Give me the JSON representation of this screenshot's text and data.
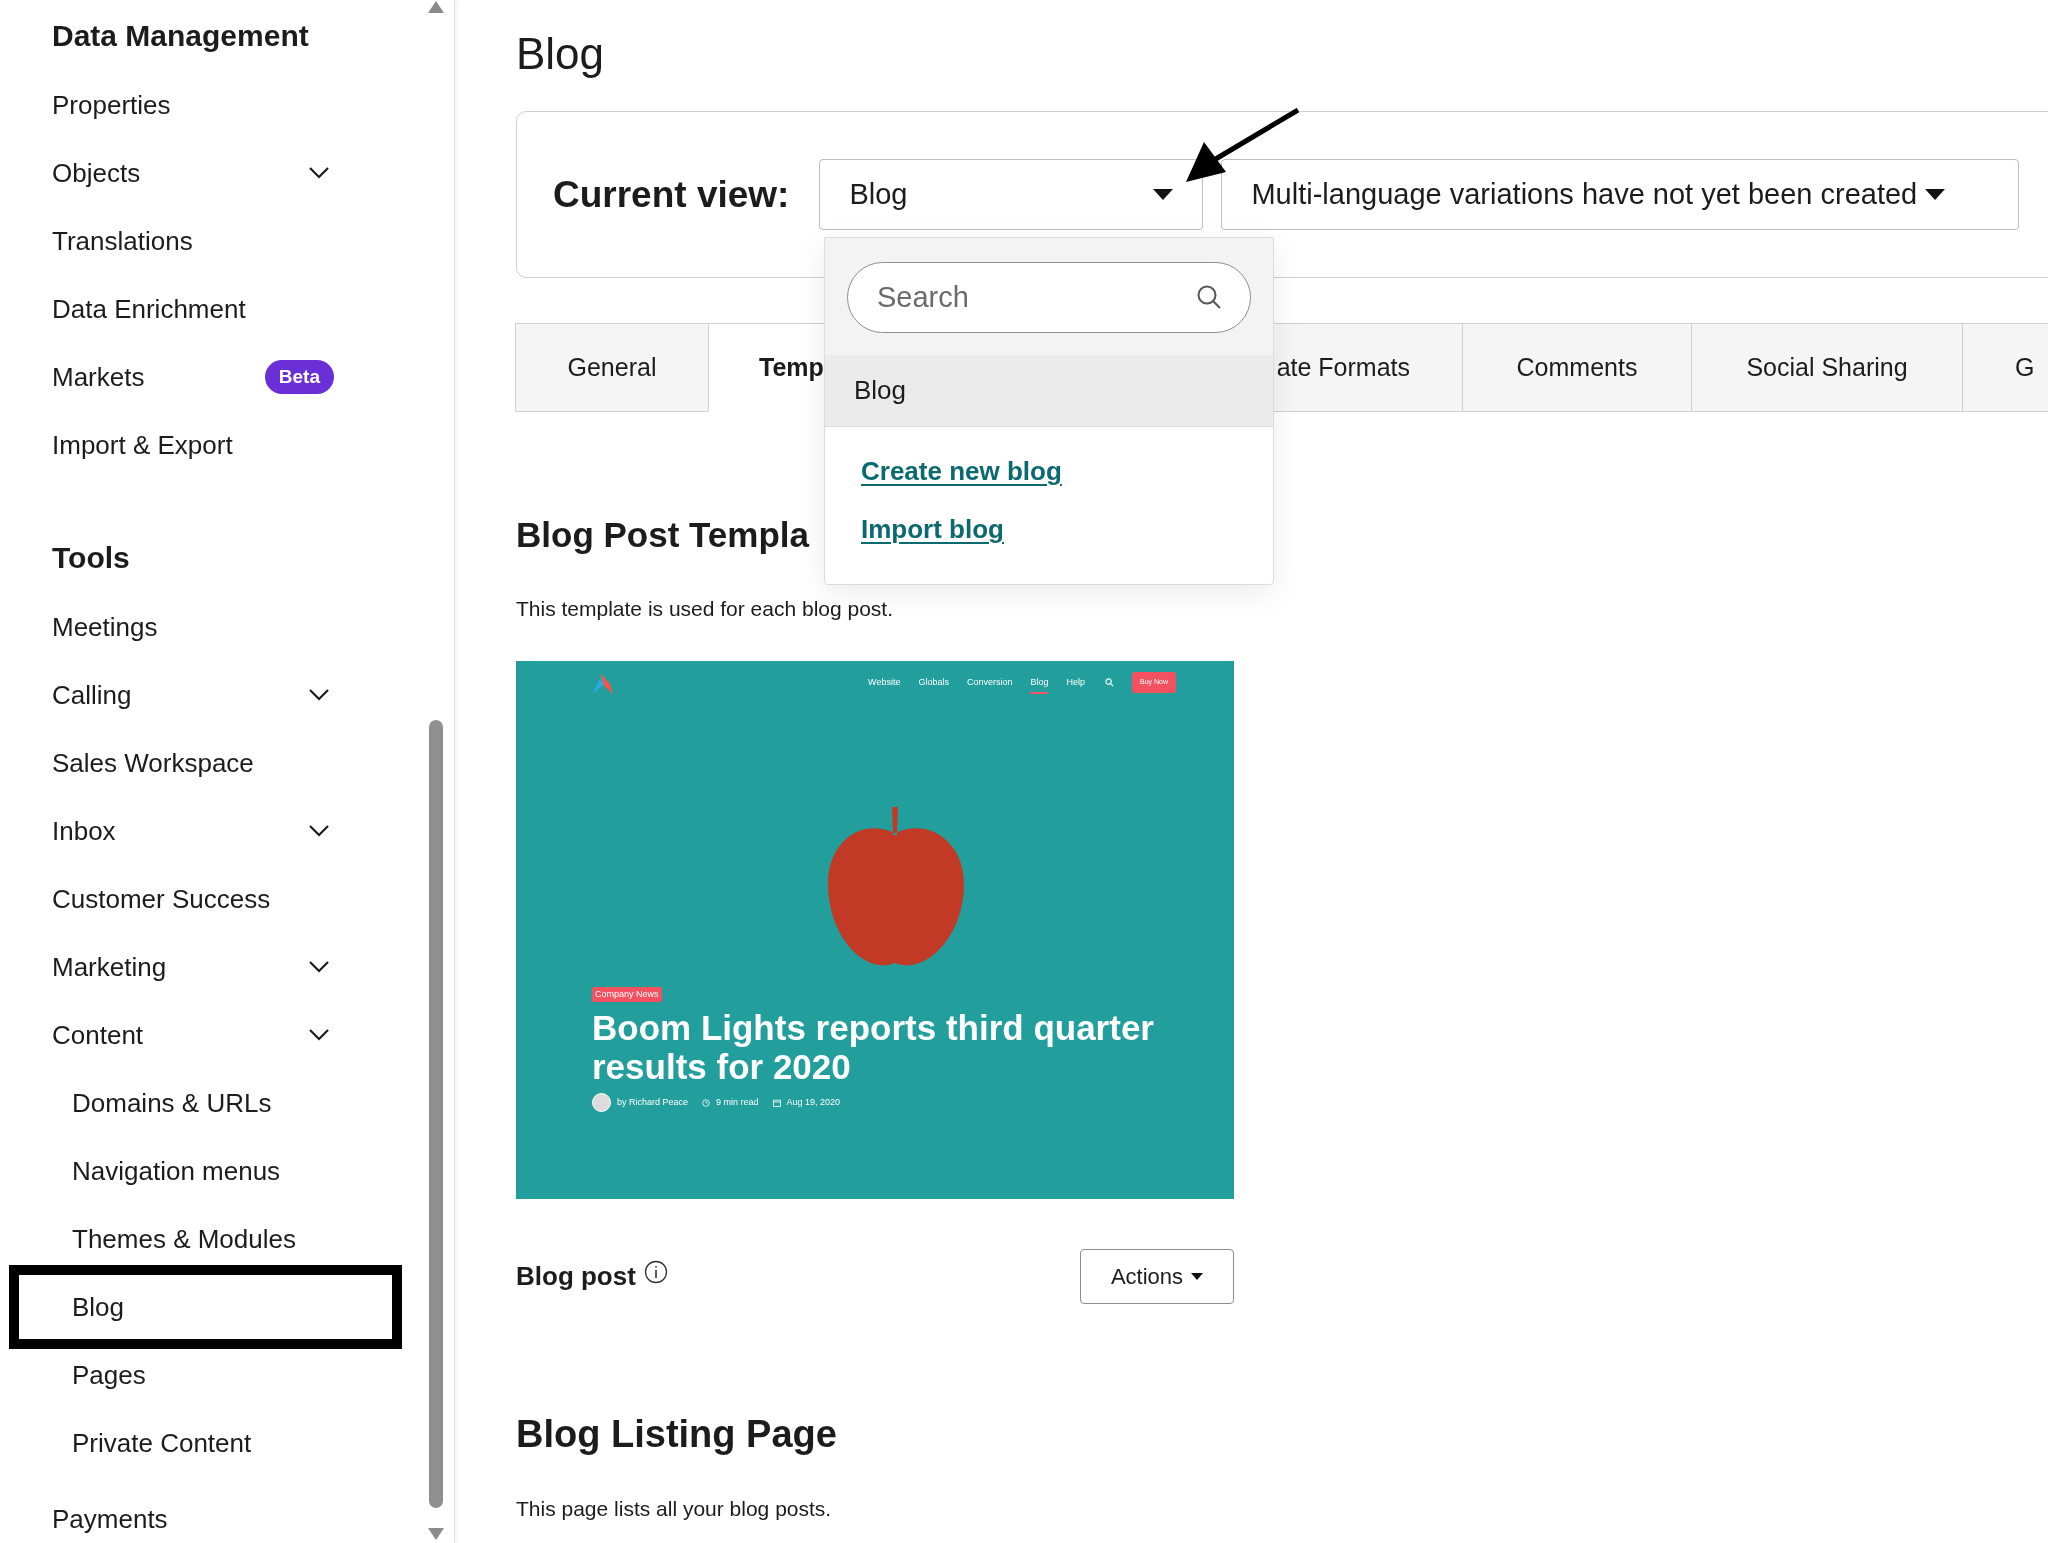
{
  "sidebar": {
    "sections": [
      {
        "title": "Data Management",
        "items": [
          {
            "label": "Properties",
            "expandable": false,
            "annotated": false
          },
          {
            "label": "Objects",
            "expandable": true,
            "annotated": false
          },
          {
            "label": "Translations",
            "expandable": false,
            "annotated": false
          },
          {
            "label": "Data Enrichment",
            "expandable": false,
            "annotated": false
          },
          {
            "label": "Markets",
            "badge": "Beta",
            "expandable": false,
            "annotated": false
          },
          {
            "label": "Import & Export",
            "expandable": false,
            "annotated": false
          }
        ]
      },
      {
        "title": "Tools",
        "items": [
          {
            "label": "Meetings",
            "expandable": false,
            "annotated": false
          },
          {
            "label": "Calling",
            "expandable": true,
            "annotated": false
          },
          {
            "label": "Sales Workspace",
            "expandable": false,
            "annotated": false
          },
          {
            "label": "Inbox",
            "expandable": true,
            "annotated": false
          },
          {
            "label": "Customer Success",
            "expandable": false,
            "annotated": false
          },
          {
            "label": "Marketing",
            "expandable": true,
            "annotated": false
          },
          {
            "label": "Content",
            "expandable": true,
            "annotated": false,
            "children": [
              {
                "label": "Domains & URLs",
                "annotated": false
              },
              {
                "label": "Navigation menus",
                "annotated": false
              },
              {
                "label": "Themes & Modules",
                "annotated": false
              },
              {
                "label": "Blog",
                "annotated": true
              },
              {
                "label": "Pages",
                "annotated": false
              },
              {
                "label": "Private Content",
                "annotated": false
              }
            ]
          },
          {
            "label": "Payments",
            "expandable": false,
            "annotated": false
          }
        ]
      }
    ]
  },
  "page_title": "Blog",
  "current_view": {
    "label": "Current view:",
    "blog_select": {
      "value": "Blog",
      "open": true
    },
    "language_select": {
      "value": "Multi-language variations have not yet been created"
    }
  },
  "dropdown": {
    "search": {
      "placeholder": "Search"
    },
    "options": [
      {
        "label": "Blog",
        "selected": true
      }
    ],
    "links": [
      "Create new blog",
      "Import blog"
    ]
  },
  "tabs": [
    {
      "label": "General",
      "selected": false
    },
    {
      "label": "Temp",
      "selected": true
    },
    {
      "label": "ate Formats",
      "selected": false
    },
    {
      "label": "Comments",
      "selected": false
    },
    {
      "label": "Social Sharing",
      "selected": false
    },
    {
      "label": "G",
      "selected": false
    }
  ],
  "sections": [
    {
      "kind": "template",
      "title": "Blog Post Templa",
      "description": "This template is used for each blog post.",
      "preview": {
        "nav": [
          {
            "label": "Website",
            "selected": false
          },
          {
            "label": "Globals",
            "selected": false
          },
          {
            "label": "Conversion",
            "selected": false
          },
          {
            "label": "Blog",
            "selected": true
          },
          {
            "label": "Help",
            "selected": false
          }
        ],
        "button": "Buy Now",
        "tag": "Company News",
        "headline": "Boom Lights reports third quarter results for 2020",
        "author": "by Richard Peace",
        "read_time": "9 min read",
        "date": "Aug 19, 2020"
      },
      "footer": {
        "label": "Blog post",
        "action": "Actions"
      }
    },
    {
      "kind": "listing",
      "title": "Blog Listing Page",
      "description": "This page lists all your blog posts."
    }
  ]
}
